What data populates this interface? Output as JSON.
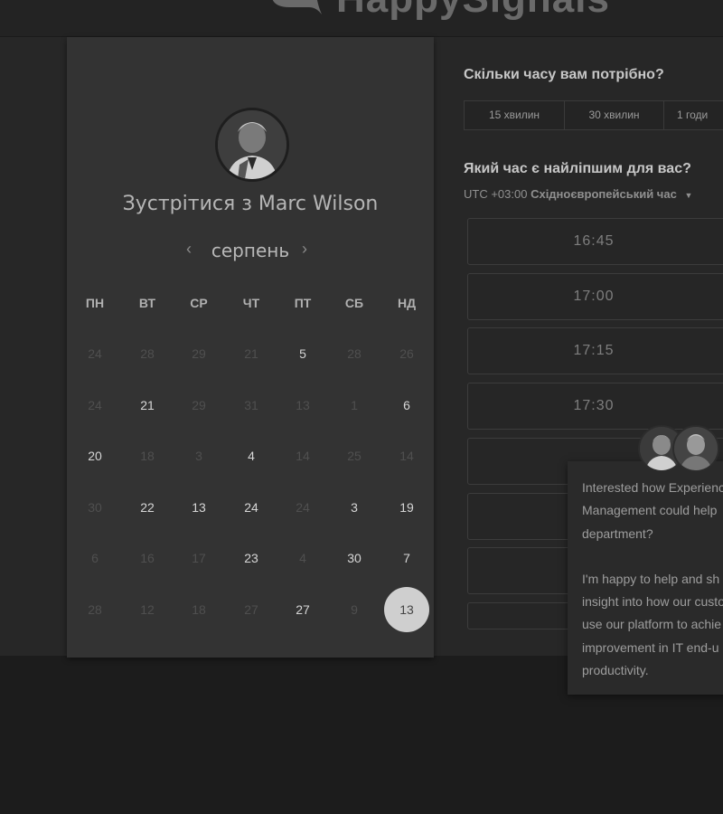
{
  "header": {
    "logo_text": "HappySignals"
  },
  "booking": {
    "meet_title": "Зустрітися з Marc Wilson",
    "month": "серпень",
    "prev_icon": "chevron-left-icon",
    "next_icon": "chevron-right-icon",
    "weekdays": [
      "ПН",
      "ВТ",
      "СР",
      "ЧТ",
      "ПТ",
      "СБ",
      "НД"
    ],
    "weeks": [
      [
        {
          "d": "24",
          "a": false
        },
        {
          "d": "28",
          "a": false
        },
        {
          "d": "29",
          "a": false
        },
        {
          "d": "21",
          "a": false
        },
        {
          "d": "5",
          "a": true
        },
        {
          "d": "28",
          "a": false
        },
        {
          "d": "26",
          "a": false
        }
      ],
      [
        {
          "d": "24",
          "a": false
        },
        {
          "d": "21",
          "a": true
        },
        {
          "d": "29",
          "a": false
        },
        {
          "d": "31",
          "a": false
        },
        {
          "d": "13",
          "a": false
        },
        {
          "d": "1",
          "a": false
        },
        {
          "d": "6",
          "a": true
        }
      ],
      [
        {
          "d": "20",
          "a": true
        },
        {
          "d": "18",
          "a": false
        },
        {
          "d": "3",
          "a": false
        },
        {
          "d": "4",
          "a": true
        },
        {
          "d": "14",
          "a": false
        },
        {
          "d": "25",
          "a": false
        },
        {
          "d": "14",
          "a": false
        }
      ],
      [
        {
          "d": "30",
          "a": false
        },
        {
          "d": "22",
          "a": true
        },
        {
          "d": "13",
          "a": true
        },
        {
          "d": "24",
          "a": true
        },
        {
          "d": "24",
          "a": false
        },
        {
          "d": "3",
          "a": true
        },
        {
          "d": "19",
          "a": true
        }
      ],
      [
        {
          "d": "6",
          "a": false
        },
        {
          "d": "16",
          "a": false
        },
        {
          "d": "17",
          "a": false
        },
        {
          "d": "23",
          "a": true
        },
        {
          "d": "4",
          "a": false
        },
        {
          "d": "30",
          "a": true
        },
        {
          "d": "7",
          "a": true
        }
      ],
      [
        {
          "d": "28",
          "a": false
        },
        {
          "d": "12",
          "a": false
        },
        {
          "d": "18",
          "a": false
        },
        {
          "d": "27",
          "a": false
        },
        {
          "d": "27",
          "a": true
        },
        {
          "d": "9",
          "a": false
        },
        {
          "d": "13",
          "a": true,
          "selected": true
        }
      ]
    ]
  },
  "duration": {
    "question": "Скільки часу вам потрібно?",
    "options": [
      "15 хвилин",
      "30 хвилин",
      "1 годи"
    ]
  },
  "time": {
    "question": "Який час є найліпшим для вас?",
    "tz_offset": "UTC +03:00",
    "tz_name": "Східноєвропейський час",
    "slots": [
      "16:45",
      "17:00",
      "17:15",
      "17:30",
      "",
      "",
      "",
      ""
    ]
  },
  "chat": {
    "paragraph1": "Interested how Experience Management could help department?",
    "paragraph2": "I'm happy to help and share insight into how our customers use our platform to achieve improvement in IT end-user productivity.",
    "line_breaks_1": [
      "Interested how Experienc",
      "Management could help",
      "department?"
    ],
    "line_breaks_2": [
      "I'm happy to help and sh",
      "insight into how our custo",
      "use our platform to achie",
      "improvement in IT end-u",
      "productivity."
    ]
  },
  "colors": {
    "page": "#272727",
    "panel": "#333333",
    "selected_day": "#cfcfcf"
  }
}
